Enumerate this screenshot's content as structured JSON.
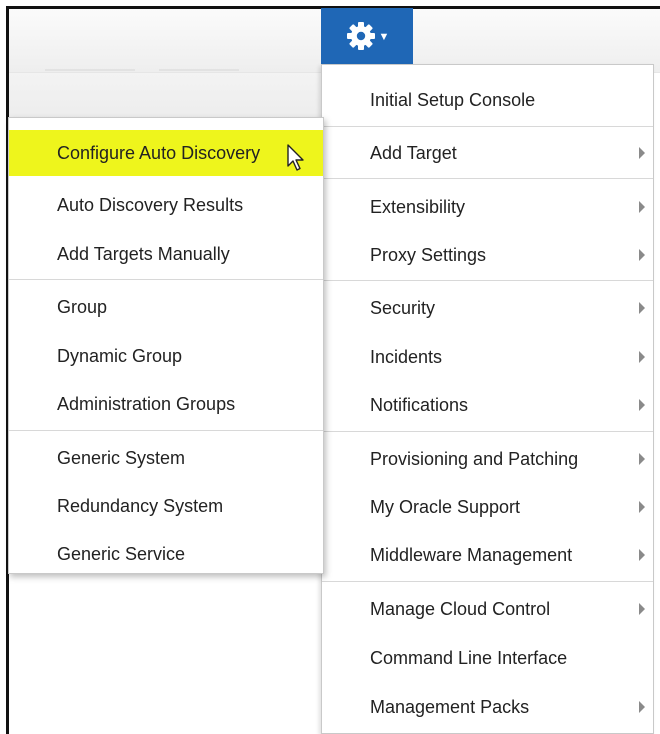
{
  "toolbar": {
    "gear_icon": "gear-icon",
    "caret_glyph": "▼",
    "button_color": "#1f67b6"
  },
  "setup_menu": {
    "items": [
      {
        "label": "Initial Setup Console",
        "submenu": false
      },
      {
        "label": "Add Target",
        "submenu": true
      },
      {
        "label": "Extensibility",
        "submenu": true
      },
      {
        "label": "Proxy Settings",
        "submenu": true
      },
      {
        "label": "Security",
        "submenu": true
      },
      {
        "label": "Incidents",
        "submenu": true
      },
      {
        "label": "Notifications",
        "submenu": true
      },
      {
        "label": "Provisioning and Patching",
        "submenu": true
      },
      {
        "label": "My Oracle Support",
        "submenu": true
      },
      {
        "label": "Middleware Management",
        "submenu": true
      },
      {
        "label": "Manage Cloud Control",
        "submenu": true
      },
      {
        "label": "Command Line Interface",
        "submenu": false
      },
      {
        "label": "Management Packs",
        "submenu": true
      }
    ]
  },
  "add_target_submenu": {
    "highlight_color": "#eef51c",
    "items": [
      {
        "label": "Configure Auto Discovery",
        "highlighted": true
      },
      {
        "label": "Auto Discovery Results",
        "highlighted": false
      },
      {
        "label": "Add Targets Manually",
        "highlighted": false
      },
      {
        "label": "Group",
        "highlighted": false
      },
      {
        "label": "Dynamic Group",
        "highlighted": false
      },
      {
        "label": "Administration Groups",
        "highlighted": false
      },
      {
        "label": "Generic System",
        "highlighted": false
      },
      {
        "label": "Redundancy System",
        "highlighted": false
      },
      {
        "label": "Generic Service",
        "highlighted": false
      }
    ]
  }
}
